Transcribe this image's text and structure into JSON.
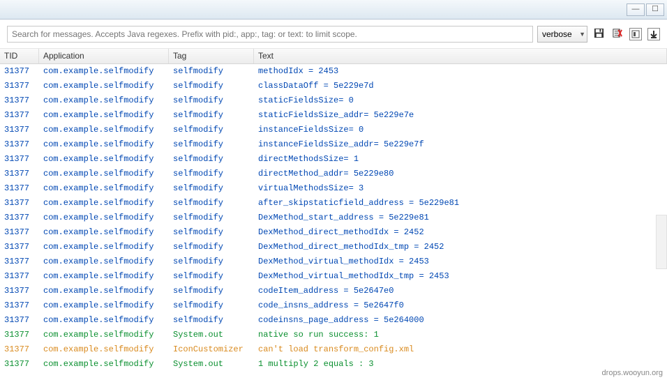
{
  "window": {
    "minimize_label": "—",
    "maximize_label": "☐"
  },
  "toolbar": {
    "search_placeholder": "Search for messages. Accepts Java regexes. Prefix with pid:, app:, tag: or text: to limit scope.",
    "level_selected": "verbose",
    "save_icon_name": "save-icon",
    "clear_icon_name": "clear-log-icon",
    "scroll_lock_icon_name": "scroll-lock-icon",
    "down_icon_name": "scroll-down-icon"
  },
  "columns": {
    "tid": "TID",
    "application": "Application",
    "tag": "Tag",
    "text": "Text"
  },
  "rows": [
    {
      "tid": "31377",
      "app": "com.example.selfmodify",
      "tag": "selfmodify",
      "text": "methodIdx = 2453",
      "color": "blue"
    },
    {
      "tid": "31377",
      "app": "com.example.selfmodify",
      "tag": "selfmodify",
      "text": " classDataOff = 5e229e7d",
      "color": "blue"
    },
    {
      "tid": "31377",
      "app": "com.example.selfmodify",
      "tag": "selfmodify",
      "text": "staticFieldsSize= 0",
      "color": "blue"
    },
    {
      "tid": "31377",
      "app": "com.example.selfmodify",
      "tag": "selfmodify",
      "text": "staticFieldsSize_addr= 5e229e7e",
      "color": "blue"
    },
    {
      "tid": "31377",
      "app": "com.example.selfmodify",
      "tag": "selfmodify",
      "text": "instanceFieldsSize= 0",
      "color": "blue"
    },
    {
      "tid": "31377",
      "app": "com.example.selfmodify",
      "tag": "selfmodify",
      "text": "instanceFieldsSize_addr= 5e229e7f",
      "color": "blue"
    },
    {
      "tid": "31377",
      "app": "com.example.selfmodify",
      "tag": "selfmodify",
      "text": "directMethodsSize= 1",
      "color": "blue"
    },
    {
      "tid": "31377",
      "app": "com.example.selfmodify",
      "tag": "selfmodify",
      "text": "directMethod_addr= 5e229e80",
      "color": "blue"
    },
    {
      "tid": "31377",
      "app": "com.example.selfmodify",
      "tag": "selfmodify",
      "text": "virtualMethodsSize= 3",
      "color": "blue"
    },
    {
      "tid": "31377",
      "app": "com.example.selfmodify",
      "tag": "selfmodify",
      "text": "after_skipstaticfield_address = 5e229e81",
      "color": "blue"
    },
    {
      "tid": "31377",
      "app": "com.example.selfmodify",
      "tag": "selfmodify",
      "text": "DexMethod_start_address = 5e229e81",
      "color": "blue"
    },
    {
      "tid": "31377",
      "app": "com.example.selfmodify",
      "tag": "selfmodify",
      "text": "DexMethod_direct_methodIdx = 2452",
      "color": "blue"
    },
    {
      "tid": "31377",
      "app": "com.example.selfmodify",
      "tag": "selfmodify",
      "text": "DexMethod_direct_methodIdx_tmp = 2452",
      "color": "blue"
    },
    {
      "tid": "31377",
      "app": "com.example.selfmodify",
      "tag": "selfmodify",
      "text": "DexMethod_virtual_methodIdx = 2453",
      "color": "blue"
    },
    {
      "tid": "31377",
      "app": "com.example.selfmodify",
      "tag": "selfmodify",
      "text": "DexMethod_virtual_methodIdx_tmp = 2453",
      "color": "blue"
    },
    {
      "tid": "31377",
      "app": "com.example.selfmodify",
      "tag": "selfmodify",
      "text": "codeItem_address = 5e2647e0",
      "color": "blue"
    },
    {
      "tid": "31377",
      "app": "com.example.selfmodify",
      "tag": "selfmodify",
      "text": "code_insns_address = 5e2647f0",
      "color": "blue"
    },
    {
      "tid": "31377",
      "app": "com.example.selfmodify",
      "tag": "selfmodify",
      "text": "codeinsns_page_address = 5e264000",
      "color": "blue"
    },
    {
      "tid": "31377",
      "app": "com.example.selfmodify",
      "tag": "System.out",
      "text": "native so run success: 1",
      "color": "green"
    },
    {
      "tid": "31377",
      "app": "com.example.selfmodify",
      "tag": "IconCustomizer",
      "text": "can't load transform_config.xml",
      "color": "orange"
    },
    {
      "tid": "31377",
      "app": "com.example.selfmodify",
      "tag": "System.out",
      "text": "1 multiply 2 equals : 3",
      "color": "green"
    }
  ],
  "watermark": "drops.wooyun.org"
}
